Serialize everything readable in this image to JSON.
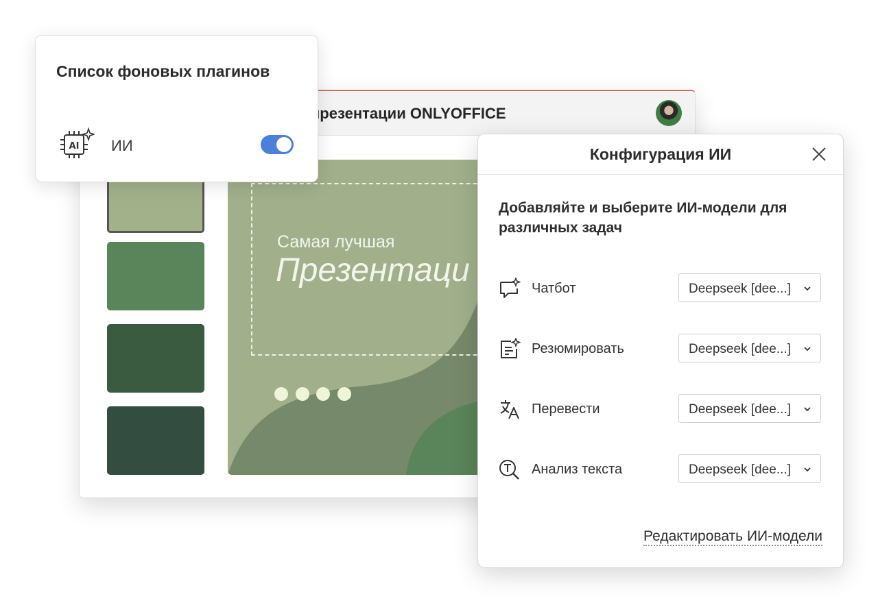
{
  "editor": {
    "title": "презентации ONLYOFFICE",
    "avatar_icon": "user-avatar",
    "slide": {
      "subtitle": "Самая лучшая",
      "title": "Презентаци"
    },
    "colors": {
      "header_accent": "#c8705e",
      "slide_light": "#a1b08b",
      "slide_mid": "#77896b",
      "slide_dark": "#5a8459"
    }
  },
  "plugins": {
    "title": "Список фоновых плагинов",
    "items": [
      {
        "icon": "ai-chip-icon",
        "label": "ИИ",
        "enabled": true
      }
    ]
  },
  "dialog": {
    "title": "Конфигурация ИИ",
    "close_icon": "close-icon",
    "description": "Добавляйте и выберите ИИ-модели для различных задач",
    "tasks": [
      {
        "icon": "chat-sparkle-icon",
        "label": "Чатбот",
        "model": "Deepseek [dee...]"
      },
      {
        "icon": "summary-icon",
        "label": "Резюмировать",
        "model": "Deepseek [dee...]"
      },
      {
        "icon": "translate-icon",
        "label": "Перевести",
        "model": "Deepseek [dee...]"
      },
      {
        "icon": "text-analysis-icon",
        "label": "Анализ текста",
        "model": "Deepseek [dee...]"
      }
    ],
    "edit_link": "Редактировать ИИ-модели"
  },
  "accent_color": "#4a80d9"
}
